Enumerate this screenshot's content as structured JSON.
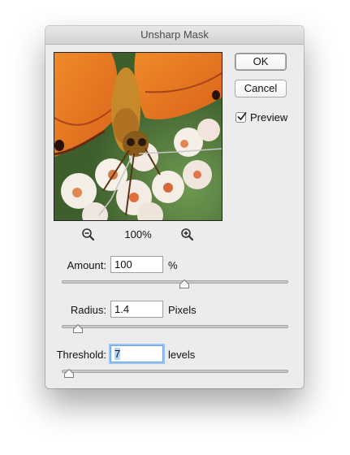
{
  "dialog": {
    "title": "Unsharp Mask"
  },
  "buttons": {
    "ok_label": "OK",
    "cancel_label": "Cancel"
  },
  "preview": {
    "label": "Preview",
    "checked": true
  },
  "zoom": {
    "level": "100%",
    "zoom_out_icon": "zoom-out-magnifier-icon",
    "zoom_in_icon": "zoom-in-magnifier-icon"
  },
  "amount": {
    "label": "Amount:",
    "value": "100",
    "unit": "%",
    "slider_fraction": 0.54
  },
  "radius": {
    "label": "Radius:",
    "value": "1.4",
    "unit": "Pixels",
    "slider_fraction": 0.07
  },
  "threshold": {
    "label": "Threshold:",
    "value": "7",
    "unit": "levels",
    "slider_fraction": 0.03
  },
  "colors": {
    "selection": "#b3d4fc",
    "focus_ring": "#9cc5f5"
  }
}
